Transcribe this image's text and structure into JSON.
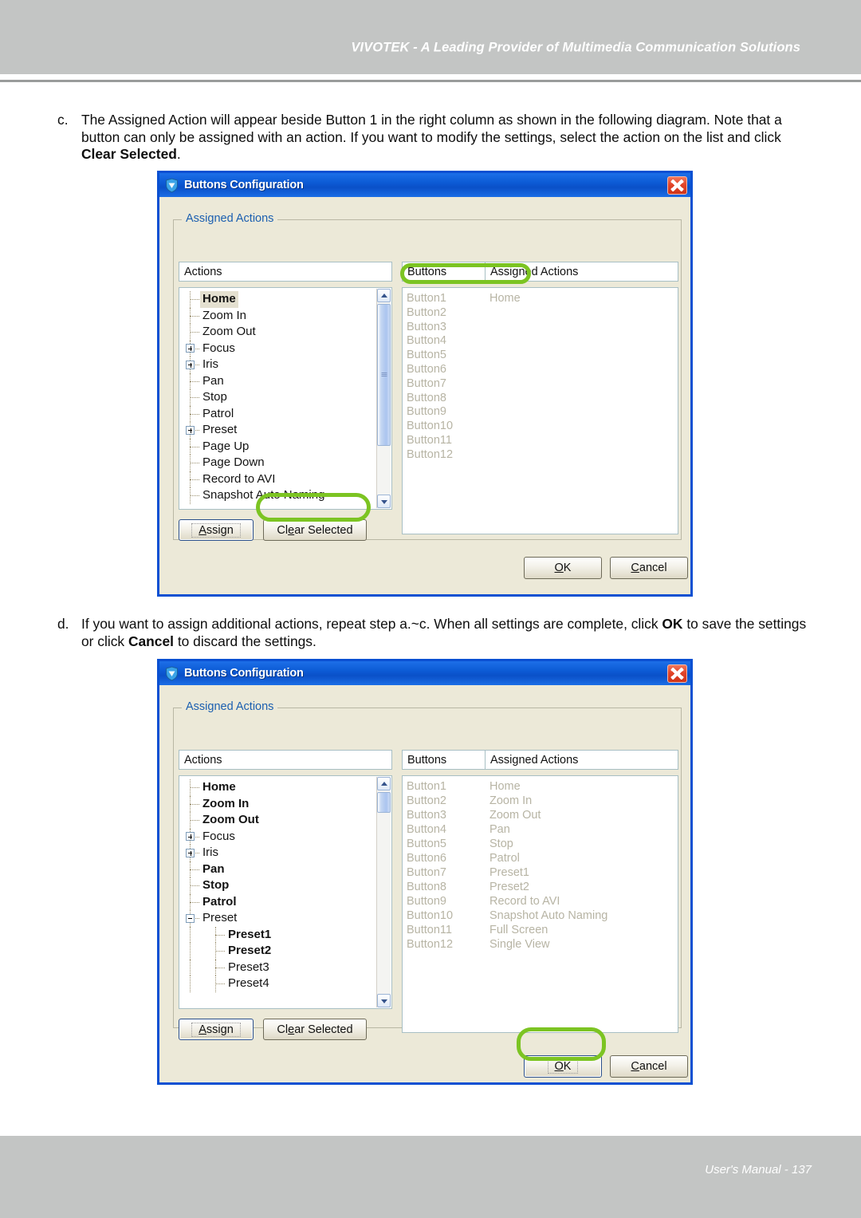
{
  "page": {
    "header_title": "VIVOTEK - A Leading Provider of Multimedia Communication Solutions",
    "footer_text": "User's Manual - 137"
  },
  "paragraphs": [
    {
      "label": "c.",
      "text": "The Assigned Action will appear beside Button 1 in the right column as shown in the following diagram. Note that a button can only be assigned with an action. If you want to modify the settings, select the action on the list and click ",
      "bold": "Clear Selected",
      "tail": "."
    },
    {
      "label": "d.",
      "text": "If you want to assign additional actions, repeat step a.~c. When all settings are complete, click ",
      "bold": "OK",
      "mid": " to save the settings or click ",
      "bold2": "Cancel",
      "tail": " to discard the settings."
    }
  ],
  "dialog1": {
    "title": "Buttons Configuration",
    "close_label": "Close",
    "group_legend": "Assigned Actions",
    "headers": {
      "actions": "Actions",
      "buttons": "Buttons",
      "assigned": "Assigned Actions"
    },
    "tree": [
      {
        "label": "Home",
        "level": 1,
        "expander": "none",
        "bold": true,
        "selected": true
      },
      {
        "label": "Zoom In",
        "level": 1,
        "expander": "none",
        "bold": false,
        "selected": false
      },
      {
        "label": "Zoom Out",
        "level": 1,
        "expander": "none",
        "bold": false,
        "selected": false
      },
      {
        "label": "Focus",
        "level": 1,
        "expander": "plus",
        "bold": false,
        "selected": false
      },
      {
        "label": "Iris",
        "level": 1,
        "expander": "plus",
        "bold": false,
        "selected": false
      },
      {
        "label": "Pan",
        "level": 1,
        "expander": "none",
        "bold": false,
        "selected": false
      },
      {
        "label": "Stop",
        "level": 1,
        "expander": "none",
        "bold": false,
        "selected": false
      },
      {
        "label": "Patrol",
        "level": 1,
        "expander": "none",
        "bold": false,
        "selected": false
      },
      {
        "label": "Preset",
        "level": 1,
        "expander": "plus",
        "bold": false,
        "selected": false
      },
      {
        "label": "Page Up",
        "level": 1,
        "expander": "none",
        "bold": false,
        "selected": false
      },
      {
        "label": "Page Down",
        "level": 1,
        "expander": "none",
        "bold": false,
        "selected": false
      },
      {
        "label": "Record to AVI",
        "level": 1,
        "expander": "none",
        "bold": false,
        "selected": false
      },
      {
        "label": "Snapshot Auto Naming",
        "level": 1,
        "expander": "none",
        "bold": false,
        "selected": false
      }
    ],
    "assigned_rows": [
      {
        "button": "Button1",
        "action": "Home"
      },
      {
        "button": "Button2",
        "action": ""
      },
      {
        "button": "Button3",
        "action": ""
      },
      {
        "button": "Button4",
        "action": ""
      },
      {
        "button": "Button5",
        "action": ""
      },
      {
        "button": "Button6",
        "action": ""
      },
      {
        "button": "Button7",
        "action": ""
      },
      {
        "button": "Button8",
        "action": ""
      },
      {
        "button": "Button9",
        "action": ""
      },
      {
        "button": "Button10",
        "action": ""
      },
      {
        "button": "Button11",
        "action": ""
      },
      {
        "button": "Button12",
        "action": ""
      }
    ],
    "buttons": {
      "assign": "Assign",
      "clear_selected": "Clear Selected",
      "ok": "OK",
      "cancel": "Cancel"
    },
    "highlight": "clear-selected"
  },
  "dialog2": {
    "title": "Buttons Configuration",
    "close_label": "Close",
    "group_legend": "Assigned Actions",
    "headers": {
      "actions": "Actions",
      "buttons": "Buttons",
      "assigned": "Assigned Actions"
    },
    "tree": [
      {
        "label": "Home",
        "level": 1,
        "expander": "none",
        "bold": true,
        "selected": false
      },
      {
        "label": "Zoom In",
        "level": 1,
        "expander": "none",
        "bold": true,
        "selected": false
      },
      {
        "label": "Zoom Out",
        "level": 1,
        "expander": "none",
        "bold": true,
        "selected": false
      },
      {
        "label": "Focus",
        "level": 1,
        "expander": "plus",
        "bold": false,
        "selected": false
      },
      {
        "label": "Iris",
        "level": 1,
        "expander": "plus",
        "bold": false,
        "selected": false
      },
      {
        "label": "Pan",
        "level": 1,
        "expander": "none",
        "bold": true,
        "selected": false
      },
      {
        "label": "Stop",
        "level": 1,
        "expander": "none",
        "bold": true,
        "selected": false
      },
      {
        "label": "Patrol",
        "level": 1,
        "expander": "none",
        "bold": true,
        "selected": false
      },
      {
        "label": "Preset",
        "level": 1,
        "expander": "minus",
        "bold": false,
        "selected": false
      },
      {
        "label": "Preset1",
        "level": 2,
        "expander": "none",
        "bold": true,
        "selected": false
      },
      {
        "label": "Preset2",
        "level": 2,
        "expander": "none",
        "bold": true,
        "selected": false
      },
      {
        "label": "Preset3",
        "level": 2,
        "expander": "none",
        "bold": false,
        "selected": false
      },
      {
        "label": "Preset4",
        "level": 2,
        "expander": "none",
        "bold": false,
        "selected": false
      }
    ],
    "assigned_rows": [
      {
        "button": "Button1",
        "action": "Home"
      },
      {
        "button": "Button2",
        "action": "Zoom In"
      },
      {
        "button": "Button3",
        "action": "Zoom Out"
      },
      {
        "button": "Button4",
        "action": "Pan"
      },
      {
        "button": "Button5",
        "action": "Stop"
      },
      {
        "button": "Button6",
        "action": "Patrol"
      },
      {
        "button": "Button7",
        "action": "Preset1"
      },
      {
        "button": "Button8",
        "action": "Preset2"
      },
      {
        "button": "Button9",
        "action": "Record to AVI"
      },
      {
        "button": "Button10",
        "action": "Snapshot Auto Naming"
      },
      {
        "button": "Button11",
        "action": "Full Screen"
      },
      {
        "button": "Button12",
        "action": "Single View"
      }
    ],
    "buttons": {
      "assign": "Assign",
      "clear_selected": "Clear Selected",
      "ok": "OK",
      "cancel": "Cancel"
    },
    "highlight": "ok"
  },
  "colors": {
    "header_band": "#c3c5c4",
    "titlebar_blue": "#0d5cd6",
    "dialog_face": "#ece9d8",
    "highlight_green": "#7cc422",
    "legend_blue": "#1b5fb0",
    "assigned_text": "#b7b4a4"
  }
}
